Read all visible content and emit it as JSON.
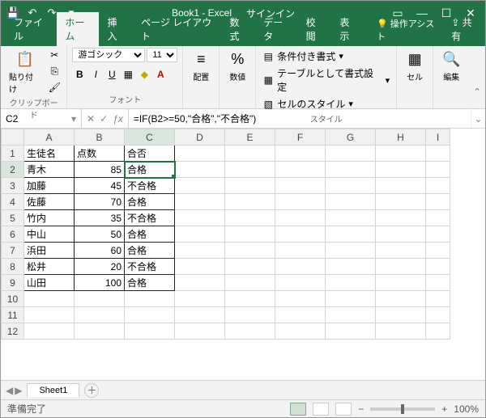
{
  "title": {
    "book": "Book1 - Excel",
    "signin": "サインイン"
  },
  "qat": {
    "save": "💾",
    "undo": "↶",
    "redo": "↷",
    "custom": "▾"
  },
  "tabs": {
    "file": "ファイル",
    "home": "ホーム",
    "insert": "挿入",
    "layout": "ページ レイアウト",
    "formulas": "数式",
    "data": "データ",
    "review": "校閲",
    "view": "表示",
    "tell": "操作アシスト",
    "share": "共有"
  },
  "ribbon": {
    "clipboard": {
      "label": "クリップボード",
      "paste": "貼り付け"
    },
    "font": {
      "label": "フォント",
      "name": "游ゴシック",
      "size": "11"
    },
    "align": {
      "label": "配置",
      "btn": "配置"
    },
    "number": {
      "label": "数値",
      "btn": "数値"
    },
    "styles": {
      "label": "スタイル",
      "cond": "条件付き書式",
      "table": "テーブルとして書式設定",
      "cell": "セルのスタイル"
    },
    "cells": {
      "label": "セル",
      "btn": "セル"
    },
    "editing": {
      "label": "編集",
      "btn": "編集"
    }
  },
  "cellref": "C2",
  "formula": "=IF(B2>=50,\"合格\",\"不合格\")",
  "cols": [
    "A",
    "B",
    "C",
    "D",
    "E",
    "F",
    "G",
    "H",
    "I"
  ],
  "rows": [
    {
      "n": 1,
      "a": "生徒名",
      "b": "点数",
      "c": "合否",
      "bordered": true,
      "balign": "left"
    },
    {
      "n": 2,
      "a": "青木",
      "b": "85",
      "c": "合格",
      "bordered": true,
      "active": true
    },
    {
      "n": 3,
      "a": "加藤",
      "b": "45",
      "c": "不合格",
      "bordered": true
    },
    {
      "n": 4,
      "a": "佐藤",
      "b": "70",
      "c": "合格",
      "bordered": true
    },
    {
      "n": 5,
      "a": "竹内",
      "b": "35",
      "c": "不合格",
      "bordered": true
    },
    {
      "n": 6,
      "a": "中山",
      "b": "50",
      "c": "合格",
      "bordered": true
    },
    {
      "n": 7,
      "a": "浜田",
      "b": "60",
      "c": "合格",
      "bordered": true
    },
    {
      "n": 8,
      "a": "松井",
      "b": "20",
      "c": "不合格",
      "bordered": true
    },
    {
      "n": 9,
      "a": "山田",
      "b": "100",
      "c": "合格",
      "bordered": true
    },
    {
      "n": 10
    },
    {
      "n": 11
    },
    {
      "n": 12
    }
  ],
  "sheet": {
    "name": "Sheet1"
  },
  "status": {
    "ready": "準備完了",
    "zoom": "100%"
  }
}
